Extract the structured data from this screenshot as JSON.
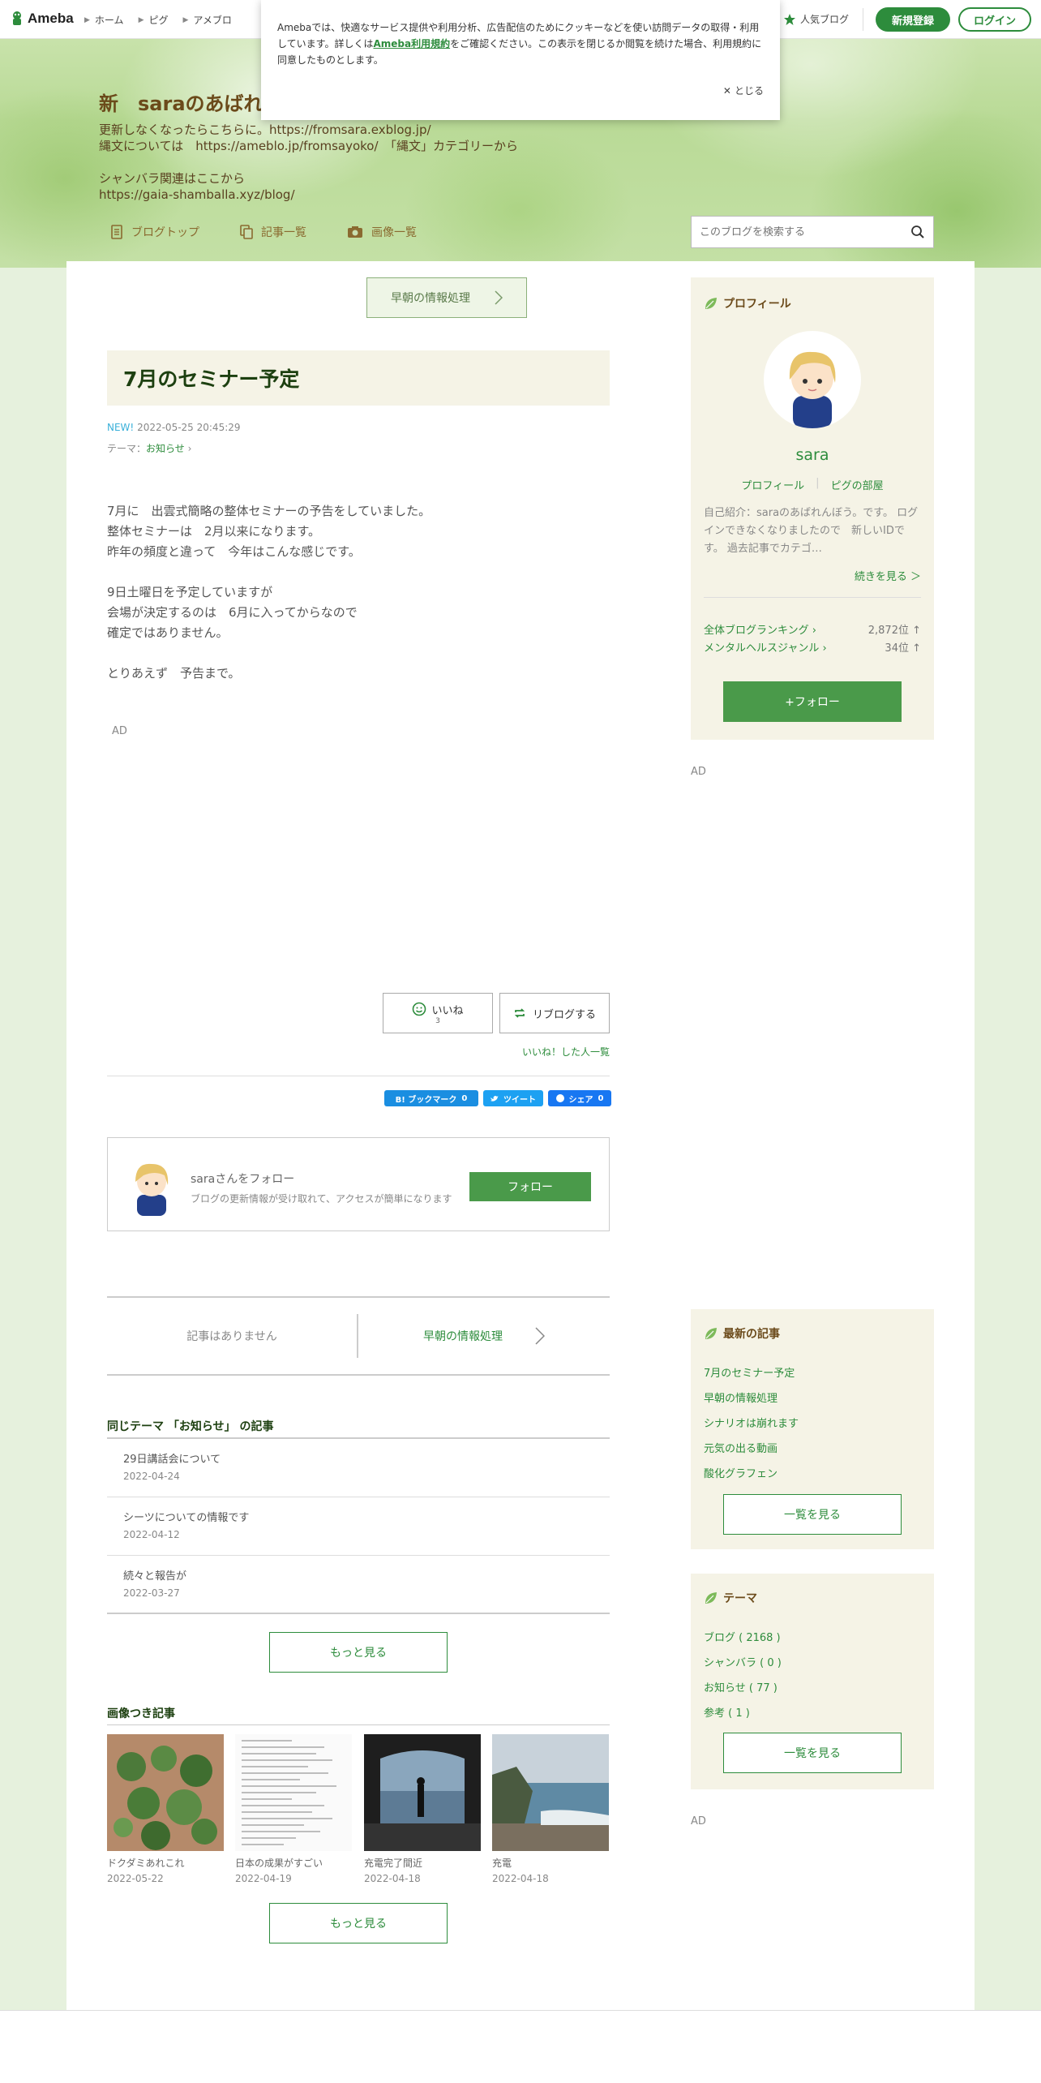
{
  "topbar": {
    "logo": "Ameba",
    "nav": [
      "ホーム",
      "ピグ",
      "アメブロ"
    ],
    "popular": "人気ブログ",
    "signup": "新規登録",
    "login": "ログイン"
  },
  "cookie": {
    "text_before": "Amebaでは、快適なサービス提供や利用分析、広告配信のためにクッキーなどを使い訪問データの取得・利用しています。詳しくは",
    "link": "Ameba利用規約",
    "text_after": "をご確認ください。この表示を閉じるか閲覧を続けた場合、利用規約に同意したものとします。",
    "close": "とじる"
  },
  "blog": {
    "title": "新　saraのあばれ",
    "description": "更新しなくなったらこちらに。https://fromsara.exblog.jp/\n縄文については　https://ameblo.jp/fromsayoko/　「縄文」カテゴリーから\n\nシャンバラ関連はここから\nhttps://gaia-shamballa.xyz/blog/",
    "nav": [
      "ブログトップ",
      "記事一覧",
      "画像一覧"
    ],
    "search_placeholder": "このブログを検索する"
  },
  "article": {
    "prev": "早朝の情報処理",
    "title": "7月のセミナー予定",
    "new_label": "NEW!",
    "datetime": "2022-05-25 20:45:29",
    "theme_label": "テーマ：",
    "theme": "お知らせ",
    "body": [
      "7月に　出雲式簡略の整体セミナーの予告をしていました。",
      "整体セミナーは　2月以来になります。",
      "昨年の頻度と違って　今年はこんな感じです。",
      "",
      "9日土曜日を予定していますが",
      "会場が決定するのは　6月に入ってからなので",
      "確定ではありません。",
      "",
      "とりあえず　予告まで。"
    ],
    "ad": "AD",
    "like": "いいね",
    "like_count": "3",
    "reblog": "リブログする",
    "liked_list": "いいね！した人一覧",
    "share": {
      "hatena": "B! ブックマーク",
      "hatena_count": "0",
      "tweet": "ツイート",
      "facebook": "シェア",
      "fb_count": "0"
    }
  },
  "follow": {
    "title": "saraさんをフォロー",
    "sub": "ブログの更新情報が受け取れて、アクセスが簡単になります",
    "button": "フォロー"
  },
  "pager": {
    "left": "記事はありません",
    "right": "早朝の情報処理"
  },
  "same_theme": {
    "title": "同じテーマ 「お知らせ」 の記事",
    "items": [
      {
        "title": "29日講話会について",
        "date": "2022-04-24"
      },
      {
        "title": "シーツについての情報です",
        "date": "2022-04-12"
      },
      {
        "title": "続々と報告が",
        "date": "2022-03-27"
      }
    ],
    "more": "もっと見る"
  },
  "image_articles": {
    "title": "画像つき記事",
    "items": [
      {
        "title": "ドクダミあれこれ",
        "date": "2022-05-22"
      },
      {
        "title": "日本の成果がすごい",
        "date": "2022-04-19"
      },
      {
        "title": "充電完了間近",
        "date": "2022-04-18"
      },
      {
        "title": "充電",
        "date": "2022-04-18"
      }
    ],
    "more": "もっと見る"
  },
  "profile": {
    "heading": "プロフィール",
    "name": "sara",
    "link1": "プロフィール",
    "link2": "ピグの部屋",
    "intro": "自己紹介：saraのあばれんぼう。です。 ログインできなくなりましたので　新しいIDです。 過去記事でカテゴ…",
    "more": "続きを見る ＞",
    "rank1_label": "全体ブログランキング",
    "rank1_value": "2,872位 ↑",
    "rank2_label": "メンタルヘルスジャンル",
    "rank2_value": "34位 ↑",
    "follow": "+フォロー",
    "ad": "AD"
  },
  "recent": {
    "heading": "最新の記事",
    "items": [
      "7月のセミナー予定",
      "早朝の情報処理",
      "シナリオは崩れます",
      "元気の出る動画",
      "酸化グラフェン"
    ],
    "more": "一覧を見る"
  },
  "themes": {
    "heading": "テーマ",
    "items": [
      "ブログ ( 2168 )",
      "シャンバラ ( 0 )",
      "お知らせ ( 77 )",
      "参考 ( 1 )"
    ],
    "more": "一覧を見る",
    "ad": "AD"
  },
  "colors": {
    "accent": "#2d8c3c",
    "title_brown": "#6b4a1a",
    "sidebar_bg": "#f5f3e6"
  }
}
